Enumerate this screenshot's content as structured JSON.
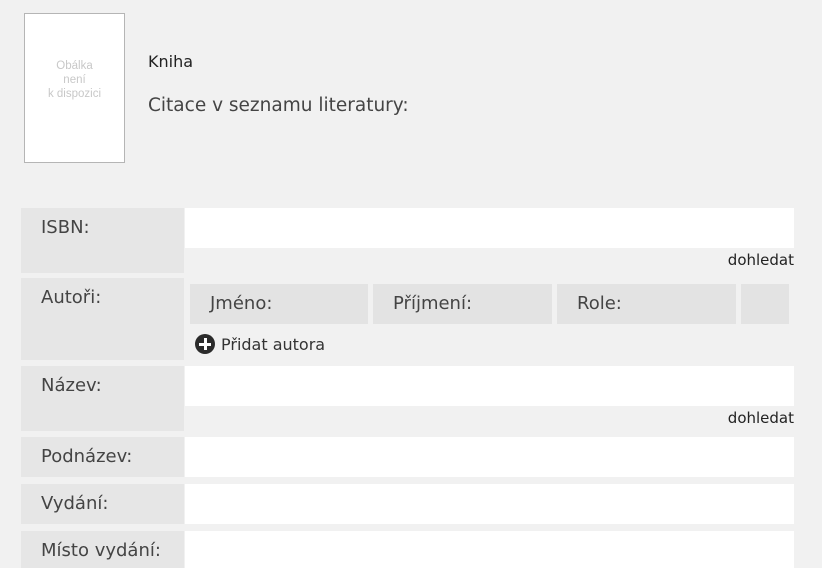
{
  "cover": {
    "lines": [
      "Obálka",
      "není",
      "k dispozici"
    ]
  },
  "document": {
    "type": "Kniha",
    "citation_label": "Citace v seznamu literatury:"
  },
  "form": {
    "isbn": {
      "label": "ISBN:",
      "value": "",
      "lookup": "dohledat"
    },
    "authors": {
      "label": "Autoři:",
      "first_name_label": "Jméno:",
      "last_name_label": "Příjmení:",
      "role_label": "Role:",
      "add_author": "Přidat autora"
    },
    "title": {
      "label": "Název:",
      "value": "",
      "lookup": "dohledat"
    },
    "subtitle": {
      "label": "Podnázev:",
      "value": ""
    },
    "edition": {
      "label": "Vydání:",
      "value": ""
    },
    "place": {
      "label": "Místo vydání:",
      "value": ""
    }
  },
  "icons": {
    "add_author": "plus-circle-icon"
  },
  "colors": {
    "background": "#f1f1f1",
    "label_cell": "#e6e6e6",
    "input": "#ffffff",
    "icon": "#2b2b2b"
  }
}
